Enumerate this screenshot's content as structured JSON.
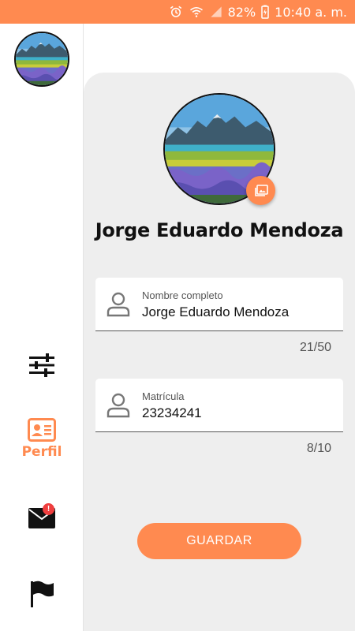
{
  "status_bar": {
    "battery": "82%",
    "time": "10:40 a. m.",
    "icons": [
      "alarm-icon",
      "wifi-icon",
      "signal-icon",
      "battery-icon"
    ],
    "background": "#ff8a50"
  },
  "sidebar": {
    "items": [
      {
        "name": "filters",
        "icon": "sliders-icon",
        "label": ""
      },
      {
        "name": "perfil",
        "icon": "id-card-icon",
        "label": "Perfil",
        "active": true
      },
      {
        "name": "messages",
        "icon": "mail-icon",
        "label": "",
        "badge": "!"
      },
      {
        "name": "flag",
        "icon": "flag-icon",
        "label": ""
      }
    ]
  },
  "profile": {
    "name": "Jorge Eduardo Mendoza"
  },
  "form": {
    "full_name": {
      "label": "Nombre completo",
      "value": "Jorge Eduardo Mendoza",
      "counter": "21/50"
    },
    "matricula": {
      "label": "Matrícula",
      "value": "23234241",
      "counter": "8/10"
    }
  },
  "actions": {
    "save_label": "GUARDAR"
  },
  "colors": {
    "accent": "#ff8a50",
    "panel": "#eeeeee",
    "badge": "#ef3e3e"
  }
}
